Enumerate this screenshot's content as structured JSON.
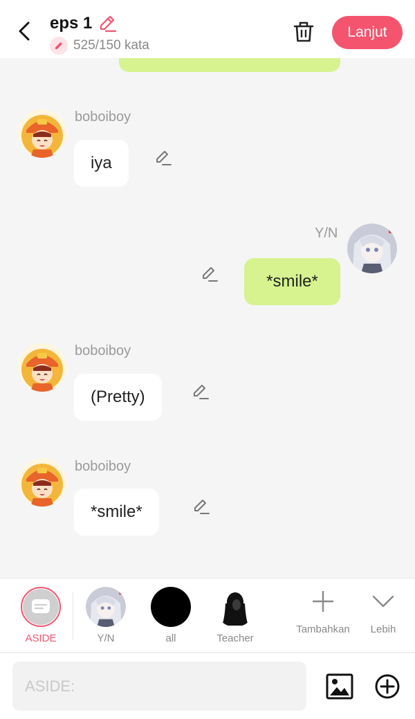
{
  "header": {
    "title": "eps 1",
    "word_count": "525/150 kata",
    "next_label": "Lanjut"
  },
  "colors": {
    "accent": "#f4546e",
    "bubble_self": "#d6f38f",
    "bubble_other": "#ffffff",
    "background": "#f5f5f5"
  },
  "messages": [
    {
      "sender": "boboiboy",
      "text": "iya",
      "side": "left"
    },
    {
      "sender": "Y/N",
      "text": "*smile*",
      "side": "right"
    },
    {
      "sender": "boboiboy",
      "text": "(Pretty)",
      "side": "left"
    },
    {
      "sender": "boboiboy",
      "text": "*smile*",
      "side": "left"
    }
  ],
  "characters": [
    {
      "label": "ASIDE",
      "icon": "aside-icon",
      "selected": true
    },
    {
      "label": "Y/N",
      "icon": "yn-avatar"
    },
    {
      "label": "all",
      "icon": "black-circle-avatar"
    },
    {
      "label": "Teacher",
      "icon": "silhouette-avatar"
    }
  ],
  "actions": {
    "add_label": "Tambahkan",
    "more_label": "Lebih"
  },
  "input": {
    "placeholder": "ASIDE:"
  }
}
